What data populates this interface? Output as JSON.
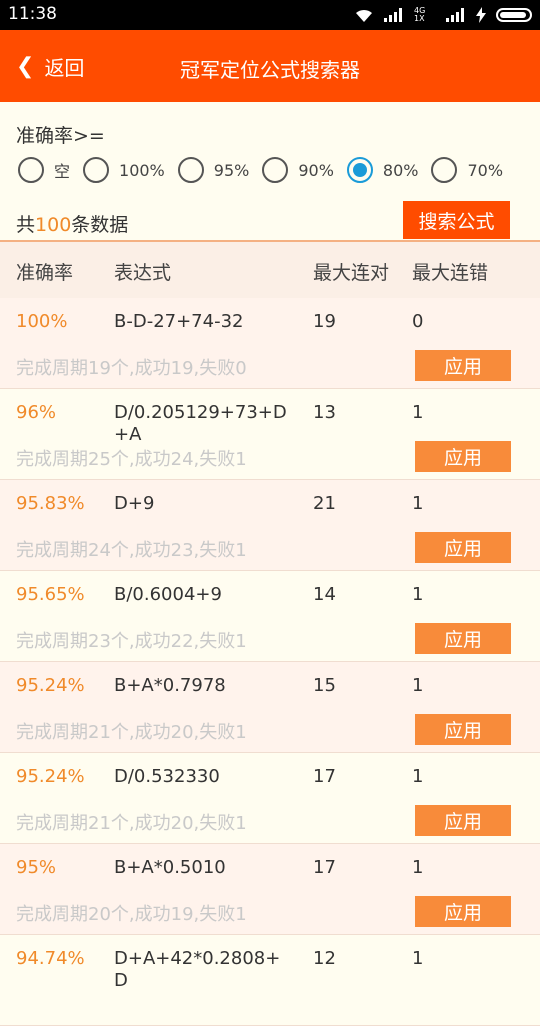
{
  "status_bar": {
    "time": "11:38",
    "network_label": "4G 1X"
  },
  "header": {
    "back_label": "返回",
    "title": "冠军定位公式搜索器"
  },
  "filter": {
    "label": "准确率>=",
    "options": [
      {
        "label": "空",
        "checked": false
      },
      {
        "label": "100%",
        "checked": false
      },
      {
        "label": "95%",
        "checked": false
      },
      {
        "label": "90%",
        "checked": false
      },
      {
        "label": "80%",
        "checked": true
      },
      {
        "label": "70%",
        "checked": false
      }
    ]
  },
  "summary_bar": {
    "prefix": "共",
    "count": "100",
    "suffix": "条数据",
    "search_label": "搜索公式"
  },
  "table": {
    "headers": [
      "准确率",
      "表达式",
      "最大连对",
      "最大连错"
    ],
    "apply_label": "应用",
    "rows": [
      {
        "accuracy": "100%",
        "expression": "B-D-27+74-32",
        "max_win": "19",
        "max_loss": "0",
        "summary": "完成周期19个,成功19,失败0"
      },
      {
        "accuracy": "96%",
        "expression": "D/0.205129+73+D+A",
        "max_win": "13",
        "max_loss": "1",
        "summary": "完成周期25个,成功24,失败1"
      },
      {
        "accuracy": "95.83%",
        "expression": "D+9",
        "max_win": "21",
        "max_loss": "1",
        "summary": "完成周期24个,成功23,失败1"
      },
      {
        "accuracy": "95.65%",
        "expression": "B/0.6004+9",
        "max_win": "14",
        "max_loss": "1",
        "summary": "完成周期23个,成功22,失败1"
      },
      {
        "accuracy": "95.24%",
        "expression": "B+A*0.7978",
        "max_win": "15",
        "max_loss": "1",
        "summary": "完成周期21个,成功20,失败1"
      },
      {
        "accuracy": "95.24%",
        "expression": "D/0.532330",
        "max_win": "17",
        "max_loss": "1",
        "summary": "完成周期21个,成功20,失败1"
      },
      {
        "accuracy": "95%",
        "expression": "B+A*0.5010",
        "max_win": "17",
        "max_loss": "1",
        "summary": "完成周期20个,成功19,失败1"
      },
      {
        "accuracy": "94.74%",
        "expression": "D+A+42*0.2808+D",
        "max_win": "12",
        "max_loss": "1",
        "summary": ""
      }
    ]
  }
}
